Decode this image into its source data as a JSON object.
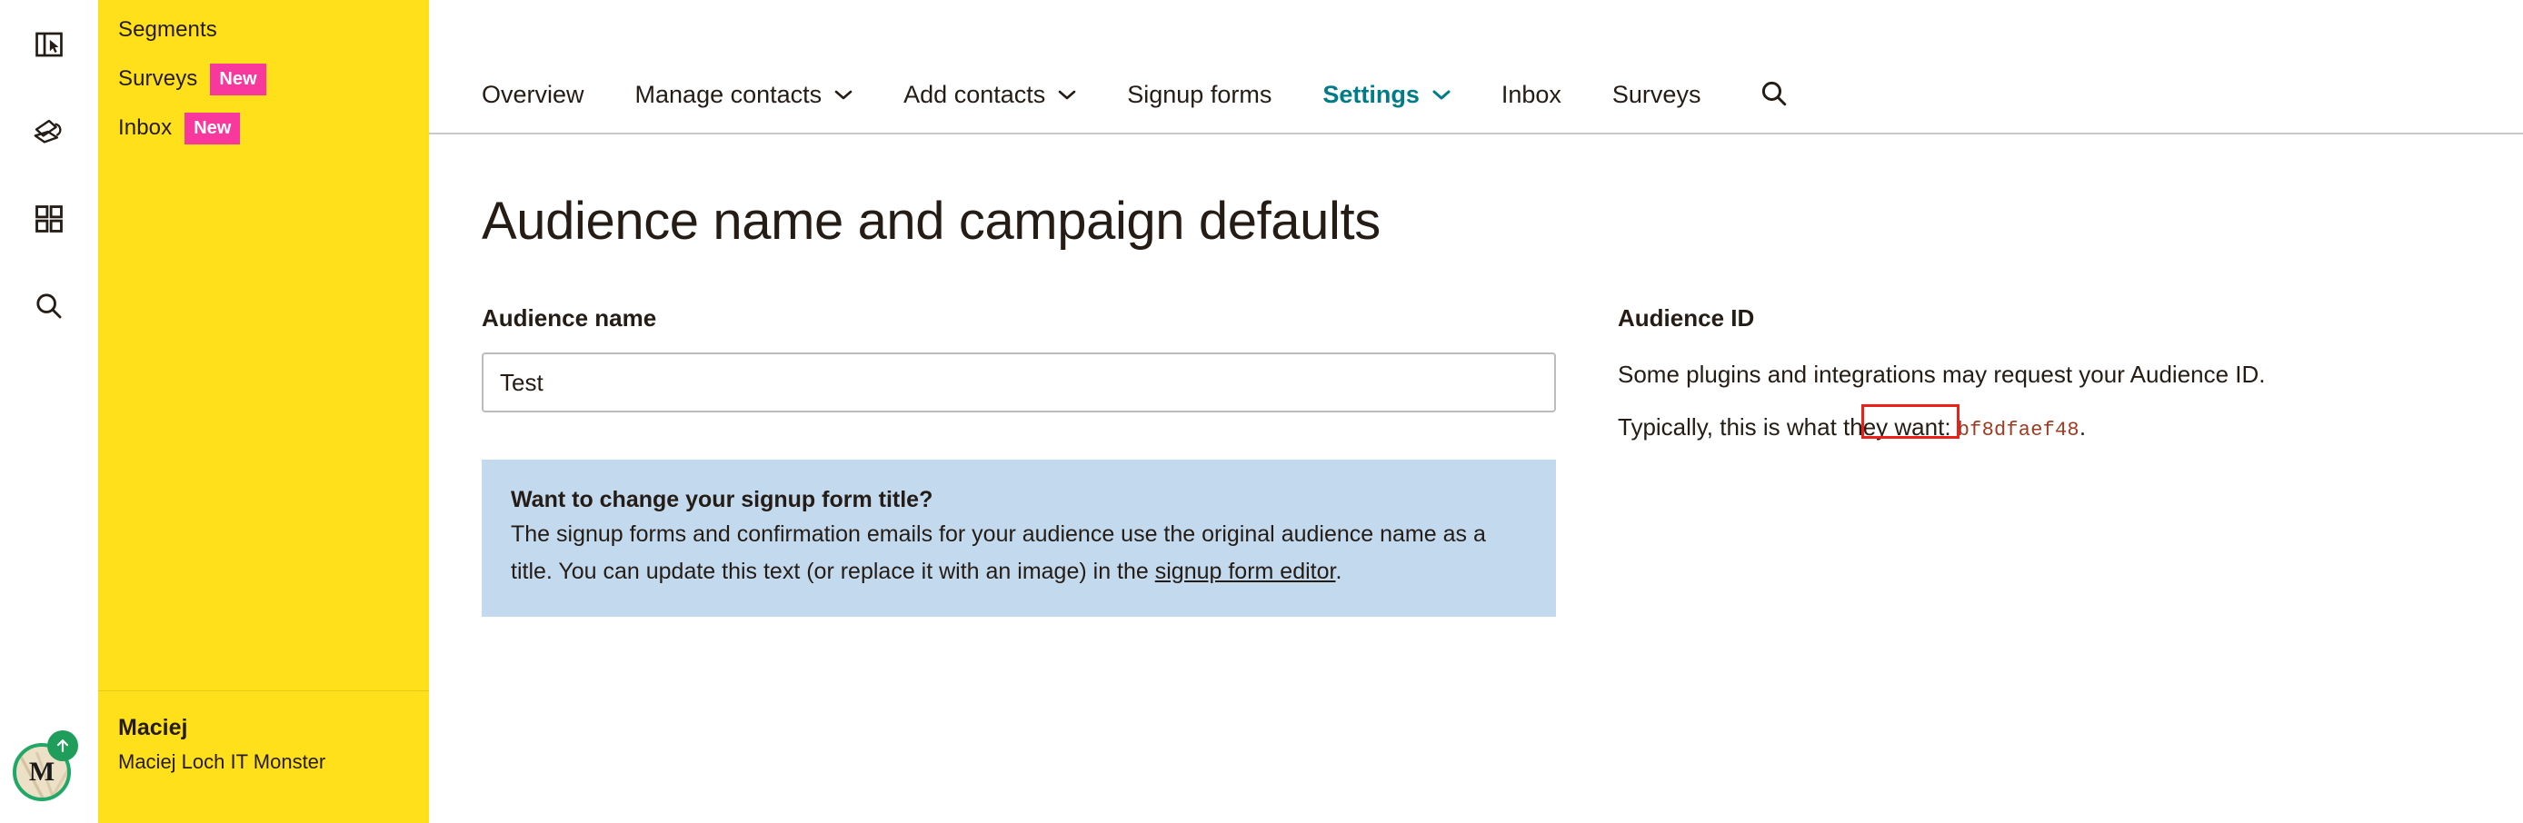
{
  "rail": {
    "icons": [
      {
        "name": "sidebar-toggle-icon",
        "label": "Toggle sidebar"
      },
      {
        "name": "campaigns-icon",
        "label": "Campaigns"
      },
      {
        "name": "apps-grid-icon",
        "label": "Apps"
      },
      {
        "name": "search-icon",
        "label": "Search"
      }
    ],
    "avatar": {
      "initial": "M",
      "badge_icon": "upgrade-arrow-icon"
    }
  },
  "sidebar": {
    "items": [
      {
        "label": "Segments",
        "badge": ""
      },
      {
        "label": "Surveys",
        "badge": "New"
      },
      {
        "label": "Inbox",
        "badge": "New"
      }
    ],
    "user": {
      "name": "Maciej",
      "org": "Maciej Loch IT Monster"
    },
    "bg_color": "#ffe01b",
    "badge_color": "#f8389c"
  },
  "topnav": {
    "items": [
      {
        "label": "Overview",
        "caret": false,
        "active": false
      },
      {
        "label": "Manage contacts",
        "caret": true,
        "active": false
      },
      {
        "label": "Add contacts",
        "caret": true,
        "active": false
      },
      {
        "label": "Signup forms",
        "caret": false,
        "active": false
      },
      {
        "label": "Settings",
        "caret": true,
        "active": true
      },
      {
        "label": "Inbox",
        "caret": false,
        "active": false
      },
      {
        "label": "Surveys",
        "caret": false,
        "active": false
      }
    ],
    "search_icon": "search-icon",
    "active_color": "#007c89"
  },
  "page": {
    "title": "Audience name and campaign defaults"
  },
  "audience_name": {
    "label": "Audience name",
    "value": "Test",
    "placeholder": "Audience name"
  },
  "info_box": {
    "title": "Want to change your signup form title?",
    "body_1": "The signup forms and confirmation emails for your audience use the original",
    "body_2": "audience name as a title. You can update this text (or replace it with an image) in the",
    "link": "signup form editor",
    "body_3": ".",
    "bg_color": "#c3d9ee"
  },
  "audience_id": {
    "title": "Audience ID",
    "line_1": "Some plugins and integrations may request your Audience ID.",
    "line_2_prefix": "Typically, this is what they want: ",
    "code": "bf8dfaef48",
    "line_2_suffix": ".",
    "highlight_color": "#ee1f18",
    "code_color": "#a03a21"
  }
}
